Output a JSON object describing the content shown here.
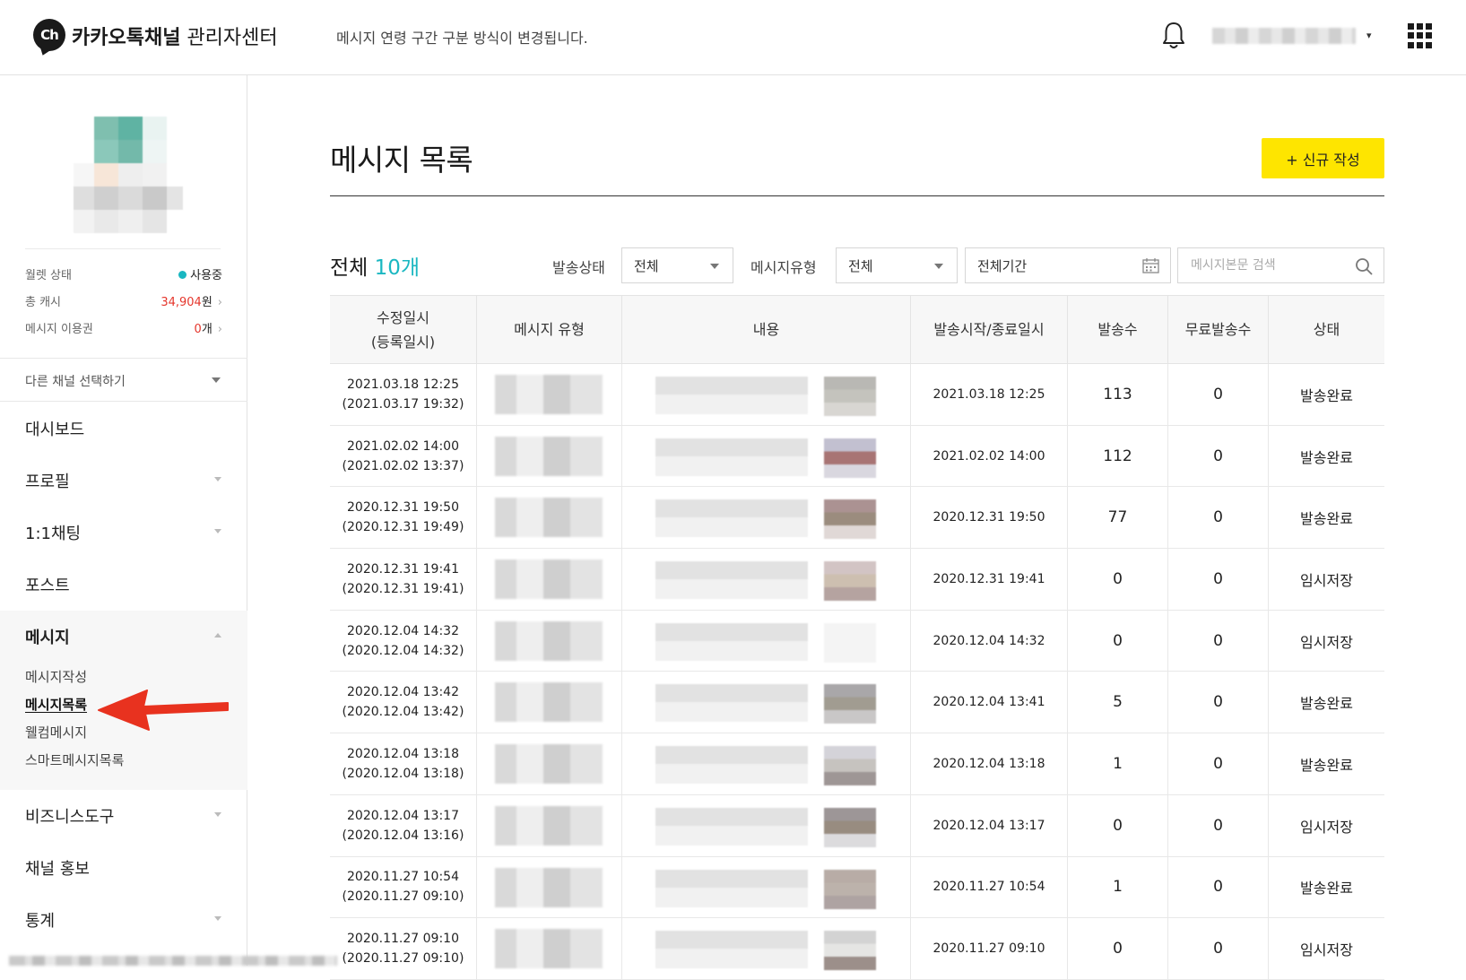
{
  "header": {
    "logo_mark": "Ch",
    "logo_bold": "카카오톡채널",
    "logo_rest": " 관리자센터",
    "notice": "메시지 연령 구간 구분 방식이 변경됩니다.",
    "account_caret": "▾",
    "icons": [
      "bell-icon",
      "apps-grid-icon"
    ]
  },
  "sidebar": {
    "stats": [
      {
        "label": "월렛 상태",
        "value": "사용중",
        "status_color": "#1ab7c1"
      },
      {
        "label": "총 캐시",
        "value": "34,904",
        "unit": "원",
        "value_color": "#e5362c"
      },
      {
        "label": "메시지 이용권",
        "value": "0",
        "unit": "개",
        "value_color": "#e5362c"
      }
    ],
    "channel_select": "다른 채널 선택하기",
    "nav": [
      {
        "label": "대시보드"
      },
      {
        "label": "프로필"
      },
      {
        "label": "1:1채팅"
      },
      {
        "label": "포스트"
      }
    ],
    "message_group": {
      "label": "메시지",
      "items": [
        "메시지작성",
        "메시지목록",
        "웰컴메시지",
        "스마트메시지목록"
      ],
      "active": "메시지목록"
    },
    "nav_after": [
      {
        "label": "비즈니스도구"
      },
      {
        "label": "채널 홍보"
      },
      {
        "label": "통계"
      }
    ]
  },
  "main": {
    "title": "메시지 목록",
    "new_button": "+ 신규 작성",
    "total_label": "전체",
    "total_count": "10개",
    "filters": {
      "status_label": "발송상태",
      "status_value": "전체",
      "type_label": "메시지유형",
      "type_value": "전체",
      "period_value": "전체기간",
      "search_placeholder": "메시지본문 검색"
    },
    "table": {
      "headers": [
        "수정일시\n(등록일시)",
        "메시지 유형",
        "내용",
        "발송시작/종료일시",
        "발송수",
        "무료발송수",
        "상태"
      ],
      "rows": [
        {
          "modified": "2021.03.18 12:25",
          "registered": "(2021.03.17 19:32)",
          "start": "2021.03.18 12:25",
          "sent": "113",
          "free": "0",
          "status": "발송완료"
        },
        {
          "modified": "2021.02.02 14:00",
          "registered": "(2021.02.02 13:37)",
          "start": "2021.02.02 14:00",
          "sent": "112",
          "free": "0",
          "status": "발송완료"
        },
        {
          "modified": "2020.12.31 19:50",
          "registered": "(2020.12.31 19:49)",
          "start": "2020.12.31 19:50",
          "sent": "77",
          "free": "0",
          "status": "발송완료"
        },
        {
          "modified": "2020.12.31 19:41",
          "registered": "(2020.12.31 19:41)",
          "start": "2020.12.31 19:41",
          "sent": "0",
          "free": "0",
          "status": "임시저장"
        },
        {
          "modified": "2020.12.04 14:32",
          "registered": "(2020.12.04 14:32)",
          "start": "2020.12.04 14:32",
          "sent": "0",
          "free": "0",
          "status": "임시저장"
        },
        {
          "modified": "2020.12.04 13:42",
          "registered": "(2020.12.04 13:42)",
          "start": "2020.12.04 13:41",
          "sent": "5",
          "free": "0",
          "status": "발송완료"
        },
        {
          "modified": "2020.12.04 13:18",
          "registered": "(2020.12.04 13:18)",
          "start": "2020.12.04 13:18",
          "sent": "1",
          "free": "0",
          "status": "발송완료"
        },
        {
          "modified": "2020.12.04 13:17",
          "registered": "(2020.12.04 13:16)",
          "start": "2020.12.04 13:17",
          "sent": "0",
          "free": "0",
          "status": "임시저장"
        },
        {
          "modified": "2020.11.27 10:54",
          "registered": "(2020.11.27 09:10)",
          "start": "2020.11.27 10:54",
          "sent": "1",
          "free": "0",
          "status": "발송완료"
        },
        {
          "modified": "2020.11.27 09:10",
          "registered": "(2020.11.27 09:10)",
          "start": "2020.11.27 09:10",
          "sent": "0",
          "free": "0",
          "status": "임시저장"
        }
      ]
    }
  },
  "colors": {
    "brand_yellow": "#fee500",
    "accent_teal": "#1ab7c1",
    "alert_red": "#e5362c",
    "annotation_arrow": "#e8321f"
  }
}
